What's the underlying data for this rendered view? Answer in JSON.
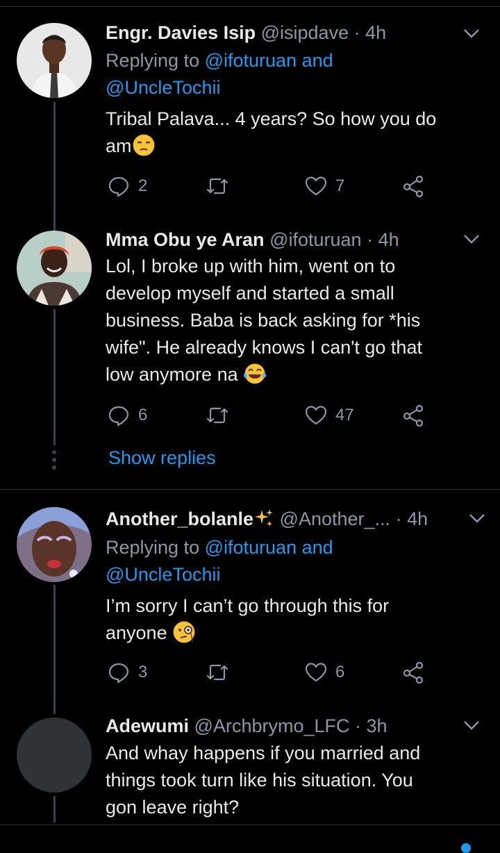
{
  "tweets": [
    {
      "name": "Engr. Davies Isip",
      "handle": "@isipdave",
      "dot": "·",
      "time": "4h",
      "replying_prefix": "Replying to",
      "replying_to_1": "@ifoturuan and",
      "replying_to_2": "@UncleTochii",
      "text_line1": "Tribal Palava... 4 years? So how you do",
      "text_line2": "am",
      "emoji": "unamused-face",
      "replies": "2",
      "retweets": "",
      "likes": "7"
    },
    {
      "name": "Mma Obu ye Aran",
      "handle": "@ifoturuan",
      "dot": "·",
      "time": "4h",
      "text_lines": [
        "Lol, I broke up with him, went on to",
        "develop myself and started a small",
        "business. Baba is back asking for *his",
        "wife\". He already knows I can't go that",
        "low anymore na"
      ],
      "emoji": "tears-of-joy-face",
      "replies": "6",
      "retweets": "",
      "likes": "47",
      "show_replies": "Show replies"
    },
    {
      "name": "Another_bolanle",
      "name_emoji": "sparkles",
      "handle": "@Another_...",
      "dot": "·",
      "time": "4h",
      "replying_prefix": "Replying to",
      "replying_to_1": "@ifoturuan and",
      "replying_to_2": "@UncleTochii",
      "text_line1": "I’m sorry I can’t go through this for",
      "text_line2": "anyone",
      "emoji": "monocle-face",
      "replies": "3",
      "retweets": "",
      "likes": "6"
    },
    {
      "name": "Adewumi",
      "handle": "@Archbrymo_LFC",
      "dot": "·",
      "time": "3h",
      "text_lines": [
        "And whay happens if you married and",
        "things took turn like his situation. You",
        "gon leave right?"
      ]
    }
  ],
  "colors": {
    "background": "#000000",
    "link": "#1d9bf0",
    "secondary_text": "#8b98a5",
    "primary_text": "#e7e9ea"
  }
}
